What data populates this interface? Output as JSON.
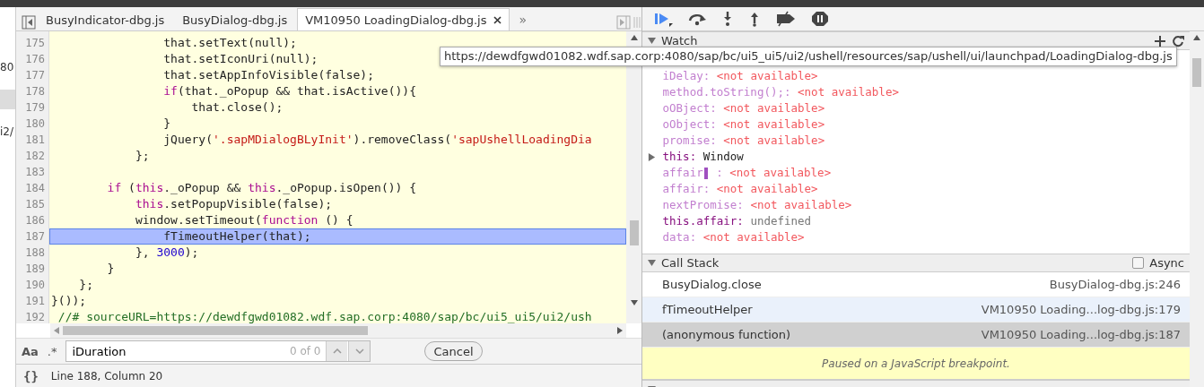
{
  "navigator": {
    "items": [
      {
        "text": "80",
        "selected": false
      },
      {
        "selected": true
      },
      {
        "text": "i2/",
        "selected": false
      }
    ]
  },
  "tabs": [
    {
      "label": "BusyIndicator-dbg.js",
      "selected": false,
      "closable": false
    },
    {
      "label": "BusyDialog-dbg.js",
      "selected": false,
      "closable": false
    },
    {
      "label": "VM10950 LoadingDialog-dbg.js",
      "selected": true,
      "closable": true
    }
  ],
  "tabs_overflow": "»",
  "editor": {
    "lines": [
      {
        "number": "175",
        "current": false,
        "segments": [
          {
            "kind": "plain",
            "text": "                that.setText(null);"
          }
        ]
      },
      {
        "number": "176",
        "current": false,
        "segments": [
          {
            "kind": "plain",
            "text": "                that.setIconUri(null);"
          }
        ]
      },
      {
        "number": "177",
        "current": false,
        "segments": [
          {
            "kind": "plain",
            "text": "                that.setAppInfoVisible(false);"
          }
        ]
      },
      {
        "number": "178",
        "current": false,
        "segments": [
          {
            "kind": "keyword",
            "text": "                if"
          },
          {
            "kind": "plain",
            "text": "(that._oPopup && that.isActive()){"
          }
        ]
      },
      {
        "number": "179",
        "current": false,
        "segments": [
          {
            "kind": "plain",
            "text": "                    that.close();"
          }
        ]
      },
      {
        "number": "180",
        "current": false,
        "segments": [
          {
            "kind": "plain",
            "text": "                }"
          }
        ]
      },
      {
        "number": "181",
        "current": false,
        "segments": [
          {
            "kind": "plain",
            "text": "                jQuery("
          },
          {
            "kind": "string",
            "text": "'.sapMDialogBLyInit'"
          },
          {
            "kind": "plain",
            "text": ").removeClass("
          },
          {
            "kind": "string",
            "text": "'sapUshellLoadingDia"
          }
        ]
      },
      {
        "number": "182",
        "current": false,
        "segments": [
          {
            "kind": "plain",
            "text": "            };"
          }
        ]
      },
      {
        "number": "183",
        "current": false
      },
      {
        "number": "184",
        "current": false,
        "segments": [
          {
            "kind": "keyword",
            "text": "        if"
          },
          {
            "kind": "plain",
            "text": " ("
          },
          {
            "kind": "keyword",
            "text": "this"
          },
          {
            "kind": "plain",
            "text": "._oPopup && "
          },
          {
            "kind": "keyword",
            "text": "this"
          },
          {
            "kind": "plain",
            "text": "._oPopup.isOpen()) {"
          }
        ]
      },
      {
        "number": "185",
        "current": false,
        "segments": [
          {
            "kind": "keyword",
            "text": "            this"
          },
          {
            "kind": "plain",
            "text": ".setPopupVisible(false);"
          }
        ]
      },
      {
        "number": "186",
        "current": false,
        "segments": [
          {
            "kind": "plain",
            "text": "            window.setTimeout("
          },
          {
            "kind": "keyword",
            "text": "function"
          },
          {
            "kind": "plain",
            "text": " () {"
          }
        ]
      },
      {
        "number": "187",
        "current": true,
        "segments": [
          {
            "kind": "plain",
            "text": "                fTimeoutHelper(that);"
          }
        ]
      },
      {
        "number": "188",
        "current": false,
        "segments": [
          {
            "kind": "plain",
            "text": "            }, "
          },
          {
            "kind": "number",
            "text": "3000"
          },
          {
            "kind": "plain",
            "text": ");"
          }
        ]
      },
      {
        "number": "189",
        "current": false,
        "segments": [
          {
            "kind": "plain",
            "text": "        }"
          }
        ]
      },
      {
        "number": "190",
        "current": false,
        "segments": [
          {
            "kind": "plain",
            "text": "    };"
          }
        ]
      },
      {
        "number": "191",
        "current": false,
        "segments": [
          {
            "kind": "plain",
            "text": "}());"
          }
        ]
      },
      {
        "number": "192",
        "current": false,
        "segments": [
          {
            "kind": "comment",
            "text": " //# sourceURL=https://dewdfgwd01082.wdf.sap.corp:4080/sap/bc/ui5_ui5/ui2/ush"
          }
        ]
      }
    ]
  },
  "search": {
    "case_label": "Aa",
    "regex_label": ".*",
    "value": "iDuration",
    "count": "0 of 0",
    "cancel": "Cancel"
  },
  "status_bar": {
    "format_label": "{}",
    "position": "Line 188, Column 20"
  },
  "watch": {
    "title": "Watch",
    "expanded": true,
    "items": [
      {
        "name": "iDelay:",
        "value": "<not available>",
        "kind": "unavailable",
        "expandable": false,
        "editing": false
      },
      {
        "name": "method.toString();:",
        "value": "<not available>",
        "kind": "unavailable",
        "expandable": false,
        "editing": false
      },
      {
        "name": "oOBject:",
        "value": "<not available>",
        "kind": "unavailable",
        "expandable": false,
        "editing": false
      },
      {
        "name": "oObject:",
        "value": "<not available>",
        "kind": "unavailable",
        "expandable": false,
        "editing": false
      },
      {
        "name": "promise:",
        "value": "<not available>",
        "kind": "unavailable",
        "expandable": false,
        "editing": false
      },
      {
        "name": "this:",
        "value": "Window",
        "kind": "object",
        "expandable": true,
        "editing": false
      },
      {
        "name": "affair",
        "suffix": ":",
        "value": "<not available>",
        "kind": "unavailable",
        "expandable": false,
        "editing": true
      },
      {
        "name": "affair:",
        "value": "<not available>",
        "kind": "unavailable",
        "expandable": false,
        "editing": false
      },
      {
        "name": "nextPromise:",
        "value": "<not available>",
        "kind": "unavailable",
        "expandable": false,
        "editing": false
      },
      {
        "name": "this.affair:",
        "value": "undefined",
        "kind": "undefined",
        "expandable": false,
        "editing": false
      },
      {
        "name": "data:",
        "value": "<not available>",
        "kind": "unavailable",
        "expandable": false,
        "editing": false
      }
    ]
  },
  "call_stack": {
    "title": "Call Stack",
    "expanded": true,
    "async": {
      "label": "Async",
      "checked": false
    },
    "frames": [
      {
        "name": "BusyDialog.close",
        "location": "BusyDialog-dbg.js:246",
        "selected": false,
        "hovered": false
      },
      {
        "name": "fTimeoutHelper",
        "location": "VM10950 Loading...log-dbg.js:179",
        "selected": false,
        "hovered": true
      },
      {
        "name": "(anonymous function)",
        "location": "VM10950 Loading...log-dbg.js:187",
        "selected": true,
        "hovered": false
      }
    ],
    "paused_message": "Paused on a JavaScript breakpoint."
  },
  "tooltip": "https://dewdfgwd01082.wdf.sap.corp:4080/sap/bc/ui5_ui5/ui2/ushell/resources/sap/ushell/ui/launchpad/LoadingDialog-dbg.js"
}
